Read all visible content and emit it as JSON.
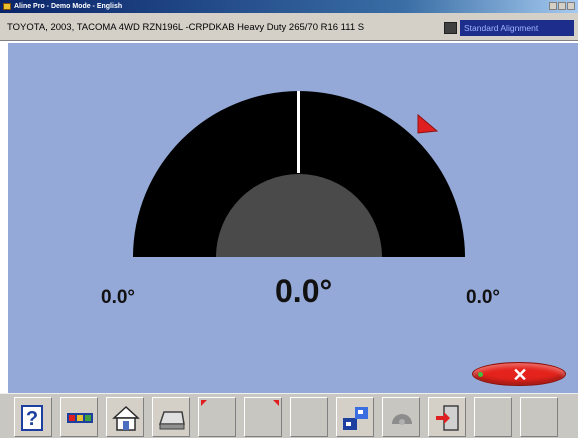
{
  "window": {
    "title": "Aline Pro - Demo Mode - English"
  },
  "vehicle": {
    "description": "TOYOTA, 2003, TACOMA 4WD RZN196L -CRPDKAB Heavy Duty 265/70 R16 111 S",
    "mode_label": "Standard Alignment"
  },
  "readings": {
    "left": "0.0°",
    "center": "0.0°",
    "right": "0.0°"
  },
  "gauge": {
    "needle_value": 0.0,
    "colors": {
      "background": "#94a9d7",
      "dial": "#000000",
      "hub": "#4a4a4a",
      "needle": "#ffffff",
      "marker": "#e02020"
    }
  },
  "cancel_button": {
    "label": "✕",
    "color": "#e4231c"
  },
  "toolbar": {
    "buttons": [
      {
        "icon": "help-icon"
      },
      {
        "icon": "vehicle-spec-icon"
      },
      {
        "icon": "home-icon"
      },
      {
        "icon": "print-icon"
      },
      {
        "icon": "empty"
      },
      {
        "icon": "empty"
      },
      {
        "icon": "empty"
      },
      {
        "icon": "adjust-icon"
      },
      {
        "icon": "tire-icon"
      },
      {
        "icon": "exit-icon"
      },
      {
        "icon": "empty"
      },
      {
        "icon": "empty"
      }
    ]
  }
}
